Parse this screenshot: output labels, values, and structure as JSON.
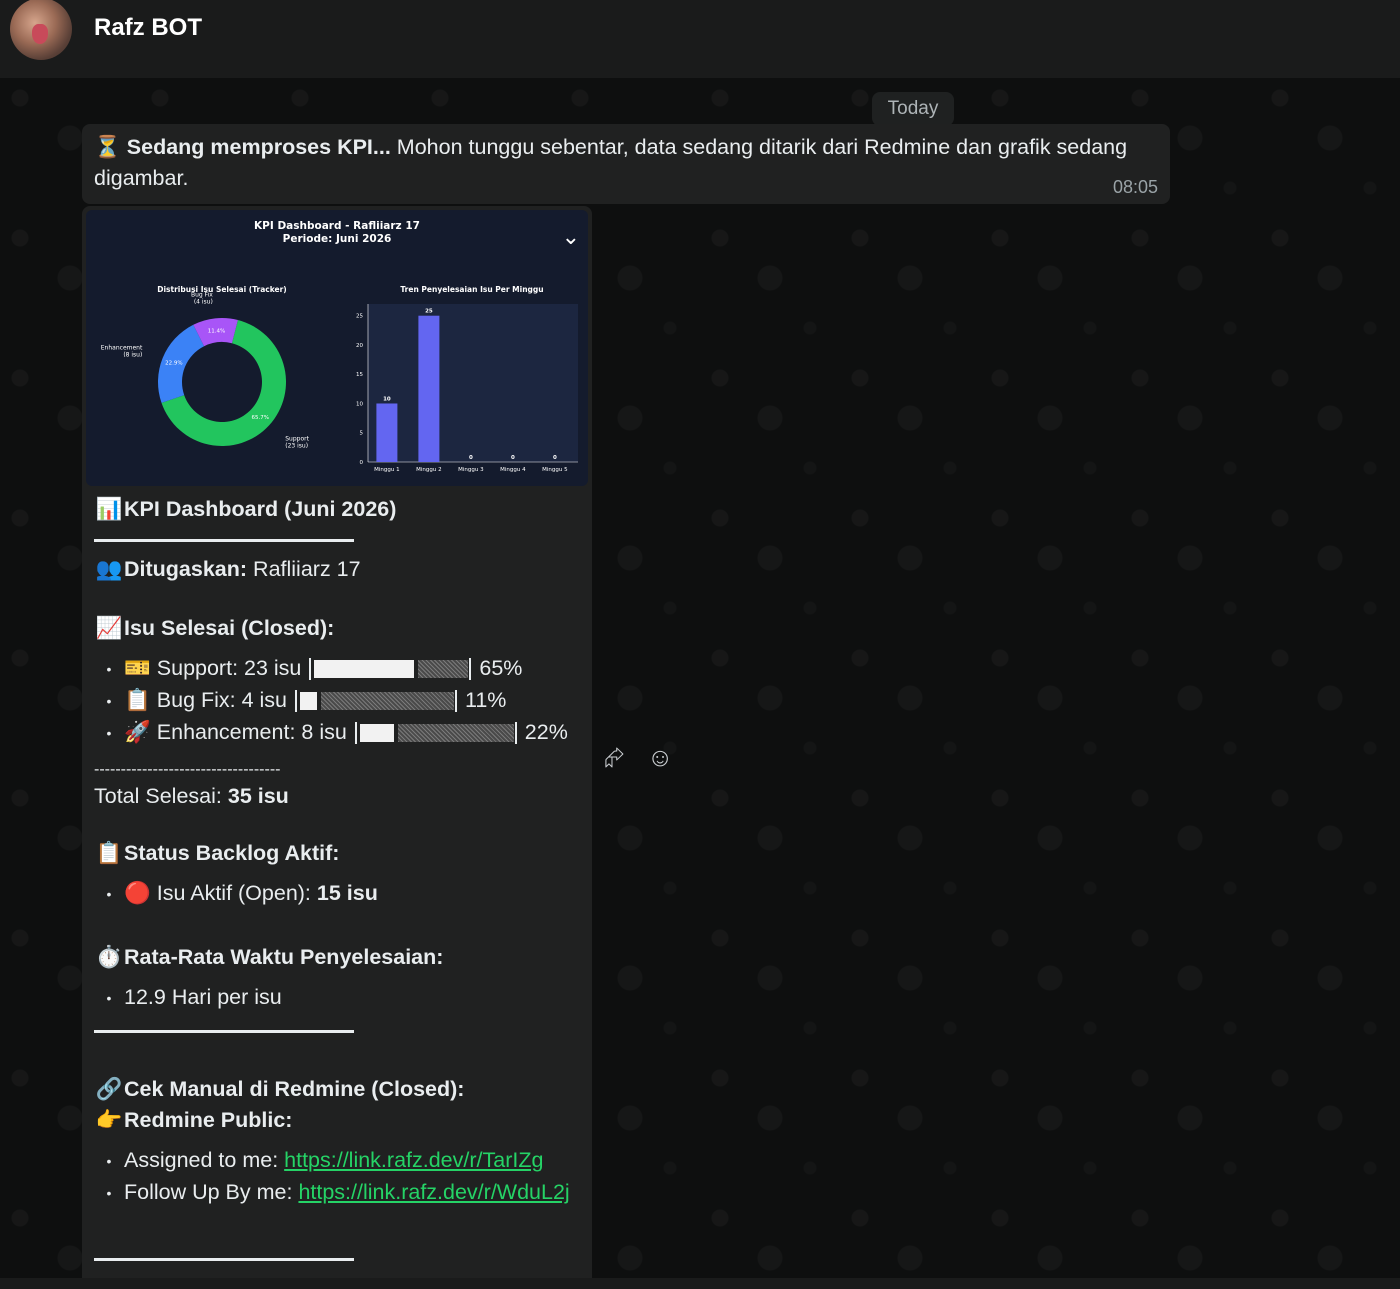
{
  "header": {
    "contact_name": "Rafz BOT"
  },
  "date_chip": "Today",
  "message1": {
    "emoji": "⏳",
    "bold": "Sedang memproses KPI...",
    "text": " Mohon tunggu sebentar, data sedang ditarik dari Redmine dan grafik sedang digambar.",
    "time": "08:05"
  },
  "chart_image": {
    "title": "KPI Dashboard - Rafliiarz 17",
    "subtitle": "Periode: Juni 2026",
    "chart_data": [
      {
        "type": "pie",
        "title": "Distribusi Isu Selesai (Tracker)",
        "slices": [
          {
            "label": "Support\n(23 isu)",
            "value": 65.7,
            "pct_label": "65.7%",
            "color": "#22c55e"
          },
          {
            "label": "Enhancement\n(8 isu)",
            "value": 22.9,
            "pct_label": "22.9%",
            "color": "#3b82f6"
          },
          {
            "label": "Bug Fix\n(4 isu)",
            "value": 11.4,
            "pct_label": "11.4%",
            "color": "#a855f7"
          }
        ]
      },
      {
        "type": "bar",
        "title": "Tren Penyelesaian Isu Per Minggu",
        "categories": [
          "Minggu 1",
          "Minggu 2",
          "Minggu 3",
          "Minggu 4",
          "Minggu 5"
        ],
        "values": [
          10,
          25,
          0,
          0,
          0
        ],
        "yticks": [
          0,
          5,
          10,
          15,
          20,
          25
        ],
        "ylim": [
          0,
          27
        ],
        "color": "#6366f1"
      }
    ]
  },
  "kpi": {
    "title_emoji": "📊",
    "title": "KPI Dashboard (Juni 2026)",
    "assigned_emoji": "👥",
    "assigned_label": "Ditugaskan:",
    "assigned_value": " Rafliiarz 17",
    "closed_emoji": "📈",
    "closed_title": "Isu Selesai (Closed):",
    "items": [
      {
        "emoji": "🎫",
        "label": "Support: 23 isu",
        "pct": "65%",
        "fill": 0.65
      },
      {
        "emoji": "📋",
        "label": "Bug Fix: 4 isu",
        "pct": "11%",
        "fill": 0.11
      },
      {
        "emoji": "🚀",
        "label": "Enhancement: 8 isu",
        "pct": "22%",
        "fill": 0.22
      }
    ],
    "dashes": "-----------------------------------",
    "total_label": "Total Selesai: ",
    "total_value": "35 isu",
    "backlog_emoji": "📋",
    "backlog_title": "Status Backlog Aktif:",
    "open_emoji": "🔴",
    "open_label": "Isu Aktif (Open): ",
    "open_value": "15 isu",
    "avg_emoji": "⏱️",
    "avg_title": "Rata-Rata Waktu Penyelesaian:",
    "avg_value": "12.9 Hari per isu",
    "manual_emoji": "🔗",
    "manual_title": "Cek Manual di Redmine (Closed):",
    "public_emoji": "👉",
    "public_title": "Redmine Public:",
    "assigned_link_label": "Assigned to me: ",
    "assigned_link": "https://link.rafz.dev/r/TarIZg",
    "followup_link_label": "Follow Up By me: ",
    "followup_link": "https://link.rafz.dev/r/WduL2j"
  },
  "side_icons": [
    "forward-icon",
    "emoji-icon"
  ]
}
